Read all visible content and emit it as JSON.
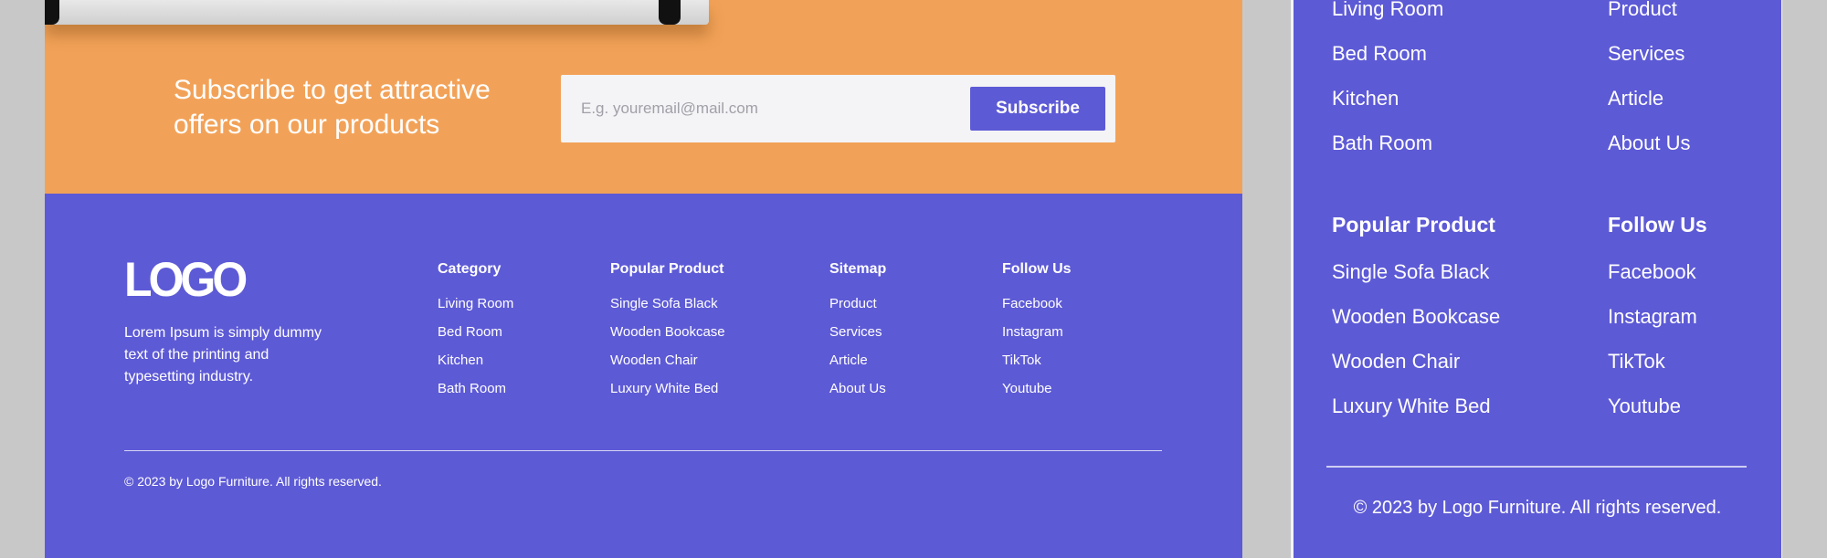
{
  "desktop": {
    "subscribe": {
      "heading_line1": "Subscribe to get attractive",
      "heading_line2": "offers on our products",
      "email_placeholder": "E.g. youremail@mail.com",
      "button_label": "Subscribe"
    },
    "footer": {
      "logo": "LOGO",
      "description": "Lorem Ipsum is simply dummy text of the printing and typesetting industry.",
      "columns": [
        {
          "title": "Category",
          "items": [
            "Living Room",
            "Bed Room",
            "Kitchen",
            "Bath Room"
          ]
        },
        {
          "title": "Popular Product",
          "items": [
            "Single Sofa Black",
            "Wooden Bookcase",
            "Wooden Chair",
            "Luxury White Bed"
          ]
        },
        {
          "title": "Sitemap",
          "items": [
            "Product",
            "Services",
            "Article",
            "About Us"
          ]
        },
        {
          "title": "Follow Us",
          "items": [
            "Facebook",
            "Instagram",
            "TikTok",
            "Youtube"
          ]
        }
      ],
      "copyright": "© 2023 by Logo Furniture. All rights reserved."
    }
  },
  "mobile": {
    "category_items": [
      "Living Room",
      "Bed Room",
      "Kitchen",
      "Bath Room"
    ],
    "sitemap_items": [
      "Product",
      "Services",
      "Article",
      "About Us"
    ],
    "popular_title": "Popular Product",
    "popular_items": [
      "Single Sofa Black",
      "Wooden Bookcase",
      "Wooden Chair",
      "Luxury White Bed"
    ],
    "follow_title": "Follow Us",
    "follow_items": [
      "Facebook",
      "Instagram",
      "TikTok",
      "Youtube"
    ],
    "copyright": "© 2023 by Logo Furniture. All rights reserved."
  },
  "colors": {
    "orange_band": "#f2a258",
    "footer_purple": "#5d5ad6",
    "background_gray": "#c8c8c8",
    "input_bg": "#f4f4f6"
  }
}
